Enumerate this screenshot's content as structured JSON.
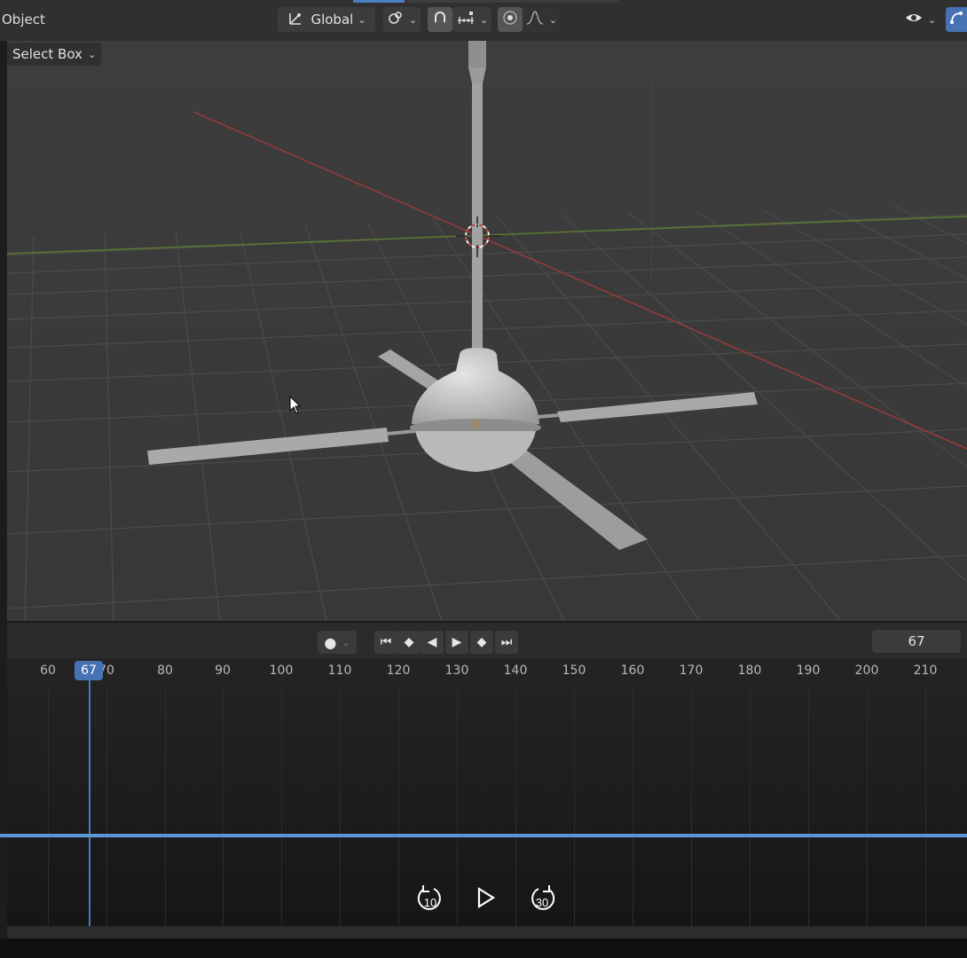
{
  "header": {
    "mode_label": "Object",
    "transform_orientation": "Global",
    "icons": [
      "transform-orientation-icon",
      "link-icon",
      "snap-icon",
      "snap-increment-icon",
      "proportional-edit-icon",
      "falloff-icon",
      "visibility-icon",
      "gizmo-icon"
    ]
  },
  "toolbar": {
    "select_mode": "Select Box"
  },
  "viewport": {
    "object": "ceiling fan",
    "grid_color": "#4a4a4a",
    "axis_x_color": "#9b3a3a",
    "axis_y_color": "#5c7a2e"
  },
  "playback": {
    "current_frame_field": "67",
    "buttons": [
      "jump-start-icon",
      "prev-keyframe-icon",
      "play-reverse-icon",
      "play-icon",
      "next-keyframe-icon",
      "jump-end-icon"
    ]
  },
  "timeline": {
    "current_frame": "67",
    "ticks": [
      "60",
      "70",
      "80",
      "90",
      "100",
      "110",
      "120",
      "130",
      "140",
      "150",
      "160",
      "170",
      "180",
      "190",
      "200",
      "210"
    ],
    "accent_color": "#4772b3"
  },
  "media": {
    "rewind_label": "10",
    "forward_label": "30"
  }
}
